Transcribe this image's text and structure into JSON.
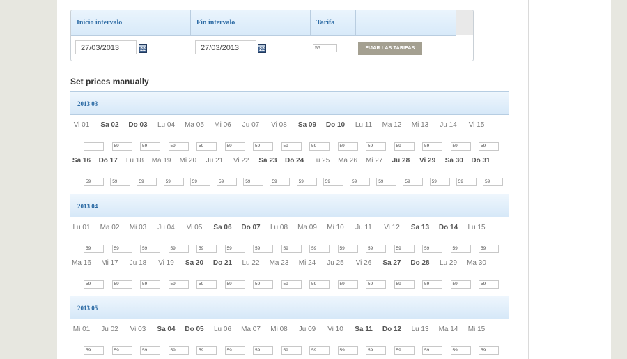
{
  "form": {
    "headers": [
      "Inicio intervalo",
      "Fin intervalo",
      "Tarifa"
    ],
    "start_date": "27/03/2013",
    "end_date": "27/03/2013",
    "calendar_icon_text": "22",
    "rate": "55",
    "set_button": "FIJAR LAS TARIFAS"
  },
  "section_title": "Set prices manually",
  "months": [
    {
      "label": "2013 03",
      "rows": [
        {
          "days": [
            {
              "label": "Vi 01",
              "price": "",
              "bold": false
            },
            {
              "label": "Sa 02",
              "price": "59",
              "bold": true
            },
            {
              "label": "Do 03",
              "price": "59",
              "bold": true
            },
            {
              "label": "Lu 04",
              "price": "59",
              "bold": false
            },
            {
              "label": "Ma 05",
              "price": "59",
              "bold": false
            },
            {
              "label": "Mi 06",
              "price": "59",
              "bold": false
            },
            {
              "label": "Ju 07",
              "price": "59",
              "bold": false
            },
            {
              "label": "Vi 08",
              "price": "59",
              "bold": false
            },
            {
              "label": "Sa 09",
              "price": "59",
              "bold": true
            },
            {
              "label": "Do 10",
              "price": "59",
              "bold": true
            },
            {
              "label": "Lu 11",
              "price": "59",
              "bold": false
            },
            {
              "label": "Ma 12",
              "price": "59",
              "bold": false
            },
            {
              "label": "Mi 13",
              "price": "59",
              "bold": false
            },
            {
              "label": "Ju 14",
              "price": "59",
              "bold": false
            },
            {
              "label": "Vi 15",
              "price": "59",
              "bold": false
            }
          ]
        },
        {
          "days": [
            {
              "label": "Sa 16",
              "price": "59",
              "bold": true
            },
            {
              "label": "Do 17",
              "price": "59",
              "bold": true
            },
            {
              "label": "Lu 18",
              "price": "59",
              "bold": false
            },
            {
              "label": "Ma 19",
              "price": "59",
              "bold": false
            },
            {
              "label": "Mi 20",
              "price": "59",
              "bold": false
            },
            {
              "label": "Ju 21",
              "price": "59",
              "bold": false
            },
            {
              "label": "Vi 22",
              "price": "59",
              "bold": false
            },
            {
              "label": "Sa 23",
              "price": "59",
              "bold": true
            },
            {
              "label": "Do 24",
              "price": "59",
              "bold": true
            },
            {
              "label": "Lu 25",
              "price": "59",
              "bold": false
            },
            {
              "label": "Ma 26",
              "price": "59",
              "bold": false
            },
            {
              "label": "Mi 27",
              "price": "59",
              "bold": false
            },
            {
              "label": "Ju 28",
              "price": "59",
              "bold": true
            },
            {
              "label": "Vi 29",
              "price": "59",
              "bold": true
            },
            {
              "label": "Sa 30",
              "price": "59",
              "bold": true
            },
            {
              "label": "Do 31",
              "price": "59",
              "bold": true
            }
          ]
        }
      ]
    },
    {
      "label": "2013 04",
      "rows": [
        {
          "days": [
            {
              "label": "Lu 01",
              "price": "59",
              "bold": false
            },
            {
              "label": "Ma 02",
              "price": "59",
              "bold": false
            },
            {
              "label": "Mi 03",
              "price": "59",
              "bold": false
            },
            {
              "label": "Ju 04",
              "price": "59",
              "bold": false
            },
            {
              "label": "Vi 05",
              "price": "59",
              "bold": false
            },
            {
              "label": "Sa 06",
              "price": "59",
              "bold": true
            },
            {
              "label": "Do 07",
              "price": "59",
              "bold": true
            },
            {
              "label": "Lu 08",
              "price": "59",
              "bold": false
            },
            {
              "label": "Ma 09",
              "price": "59",
              "bold": false
            },
            {
              "label": "Mi 10",
              "price": "59",
              "bold": false
            },
            {
              "label": "Ju 11",
              "price": "59",
              "bold": false
            },
            {
              "label": "Vi 12",
              "price": "59",
              "bold": false
            },
            {
              "label": "Sa 13",
              "price": "59",
              "bold": true
            },
            {
              "label": "Do 14",
              "price": "59",
              "bold": true
            },
            {
              "label": "Lu 15",
              "price": "59",
              "bold": false
            }
          ]
        },
        {
          "days": [
            {
              "label": "Ma 16",
              "price": "59",
              "bold": false
            },
            {
              "label": "Mi 17",
              "price": "59",
              "bold": false
            },
            {
              "label": "Ju 18",
              "price": "59",
              "bold": false
            },
            {
              "label": "Vi 19",
              "price": "59",
              "bold": false
            },
            {
              "label": "Sa 20",
              "price": "59",
              "bold": true
            },
            {
              "label": "Do 21",
              "price": "59",
              "bold": true
            },
            {
              "label": "Lu 22",
              "price": "59",
              "bold": false
            },
            {
              "label": "Ma 23",
              "price": "59",
              "bold": false
            },
            {
              "label": "Mi 24",
              "price": "59",
              "bold": false
            },
            {
              "label": "Ju 25",
              "price": "59",
              "bold": false
            },
            {
              "label": "Vi 26",
              "price": "59",
              "bold": false
            },
            {
              "label": "Sa 27",
              "price": "59",
              "bold": true
            },
            {
              "label": "Do 28",
              "price": "59",
              "bold": true
            },
            {
              "label": "Lu 29",
              "price": "59",
              "bold": false
            },
            {
              "label": "Ma 30",
              "price": "59",
              "bold": false
            }
          ]
        }
      ]
    },
    {
      "label": "2013 05",
      "rows": [
        {
          "days": [
            {
              "label": "Mi 01",
              "price": "59",
              "bold": false
            },
            {
              "label": "Ju 02",
              "price": "59",
              "bold": false
            },
            {
              "label": "Vi 03",
              "price": "59",
              "bold": false
            },
            {
              "label": "Sa 04",
              "price": "59",
              "bold": true
            },
            {
              "label": "Do 05",
              "price": "59",
              "bold": true
            },
            {
              "label": "Lu 06",
              "price": "59",
              "bold": false
            },
            {
              "label": "Ma 07",
              "price": "59",
              "bold": false
            },
            {
              "label": "Mi 08",
              "price": "59",
              "bold": false
            },
            {
              "label": "Ju 09",
              "price": "59",
              "bold": false
            },
            {
              "label": "Vi 10",
              "price": "59",
              "bold": false
            },
            {
              "label": "Sa 11",
              "price": "59",
              "bold": true
            },
            {
              "label": "Do 12",
              "price": "59",
              "bold": true
            },
            {
              "label": "Lu 13",
              "price": "59",
              "bold": false
            },
            {
              "label": "Ma 14",
              "price": "59",
              "bold": false
            },
            {
              "label": "Mi 15",
              "price": "59",
              "bold": false
            }
          ]
        }
      ]
    }
  ]
}
